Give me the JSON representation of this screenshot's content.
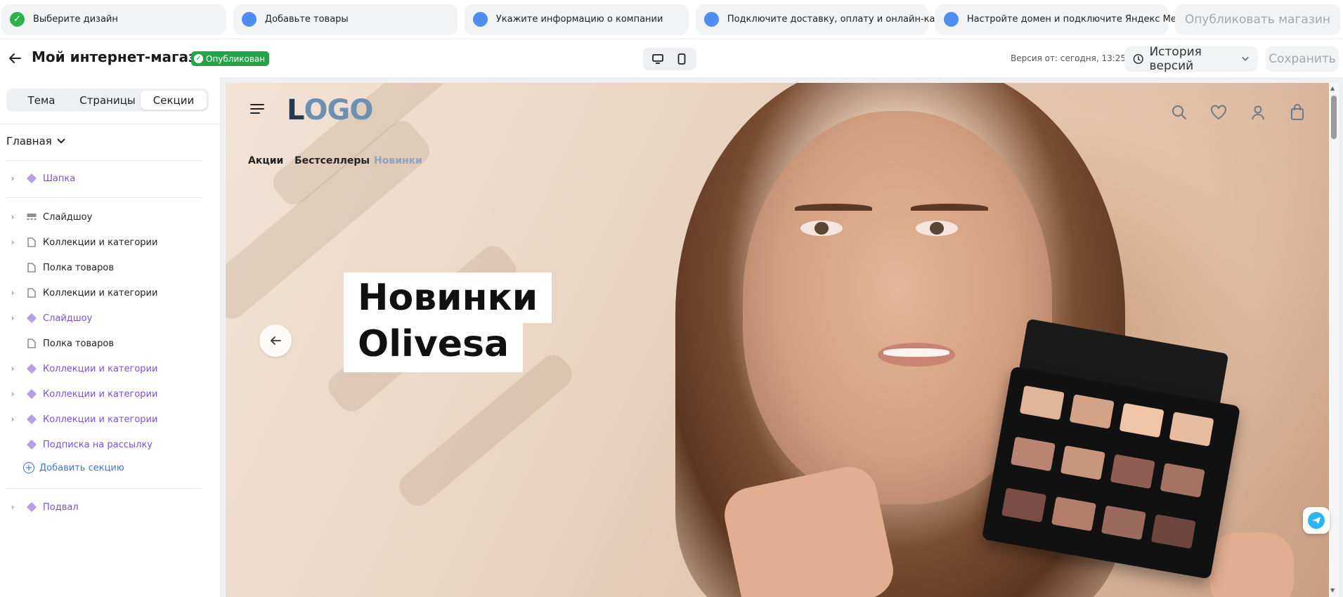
{
  "steps": [
    {
      "label": "Выберите дизайн",
      "done": true
    },
    {
      "label": "Добавьте товары",
      "done": false
    },
    {
      "label": "Укажите информацию о компании",
      "done": false
    },
    {
      "label": "Подключите доставку, оплату и онлайн-кассу",
      "done": false
    },
    {
      "label": "Настройте домен и подключите Яндекс Метрику",
      "done": false
    }
  ],
  "publish_label": "Опубликовать магазин",
  "header": {
    "title": "Мой интернет-магазин",
    "status_badge": "Опубликован",
    "version_text": "Версия от: сегодня, 13:25",
    "history_label": "История версий",
    "save_label": "Сохранить"
  },
  "sidebar": {
    "tabs": [
      {
        "label": "Тема",
        "active": false
      },
      {
        "label": "Страницы",
        "active": false
      },
      {
        "label": "Секции",
        "active": true
      }
    ],
    "page_select": "Главная",
    "sections": [
      {
        "label": "Шапка",
        "icon": "diamond-icon",
        "expandable": true,
        "color": "purple"
      },
      {
        "label": "Слайдшоу",
        "icon": "slideshow-icon",
        "expandable": true,
        "color": "dark"
      },
      {
        "label": "Коллекции и категории",
        "icon": "page-icon",
        "expandable": true,
        "color": "dark"
      },
      {
        "label": "Полка товаров",
        "icon": "page-icon",
        "expandable": false,
        "color": "dark"
      },
      {
        "label": "Коллекции и категории",
        "icon": "page-icon",
        "expandable": true,
        "color": "dark"
      },
      {
        "label": "Слайдшоу",
        "icon": "diamond-icon",
        "expandable": true,
        "color": "purple"
      },
      {
        "label": "Полка товаров",
        "icon": "page-icon",
        "expandable": false,
        "color": "dark"
      },
      {
        "label": "Коллекции и категории",
        "icon": "diamond-icon",
        "expandable": true,
        "color": "purple"
      },
      {
        "label": "Коллекции и категории",
        "icon": "diamond-icon",
        "expandable": true,
        "color": "purple"
      },
      {
        "label": "Коллекции и категории",
        "icon": "diamond-icon",
        "expandable": true,
        "color": "purple"
      },
      {
        "label": "Подписка на рассылку",
        "icon": "diamond-icon",
        "expandable": false,
        "color": "purple"
      },
      {
        "label": "Подвал",
        "icon": "diamond-icon",
        "expandable": true,
        "color": "purple"
      }
    ],
    "add_section_label": "Добавить секцию"
  },
  "preview": {
    "logo_text_dark": "L",
    "logo_text_light": "OGO",
    "nav_links": [
      {
        "label": "Акции",
        "active": false
      },
      {
        "label": "Бестселлеры",
        "active": false
      },
      {
        "label": "Новинки",
        "active": true
      }
    ],
    "hero_title_line1": "Новинки",
    "hero_title_line2": "Olivesa",
    "header_icons": [
      "search-icon",
      "heart-icon",
      "user-icon",
      "bag-icon"
    ]
  },
  "colors": {
    "accent_blue": "#4f8df2",
    "done_green": "#2eb34a",
    "badge_green": "#26a348",
    "section_purple": "#7c4fd6",
    "link_blue": "#3a75e8"
  }
}
